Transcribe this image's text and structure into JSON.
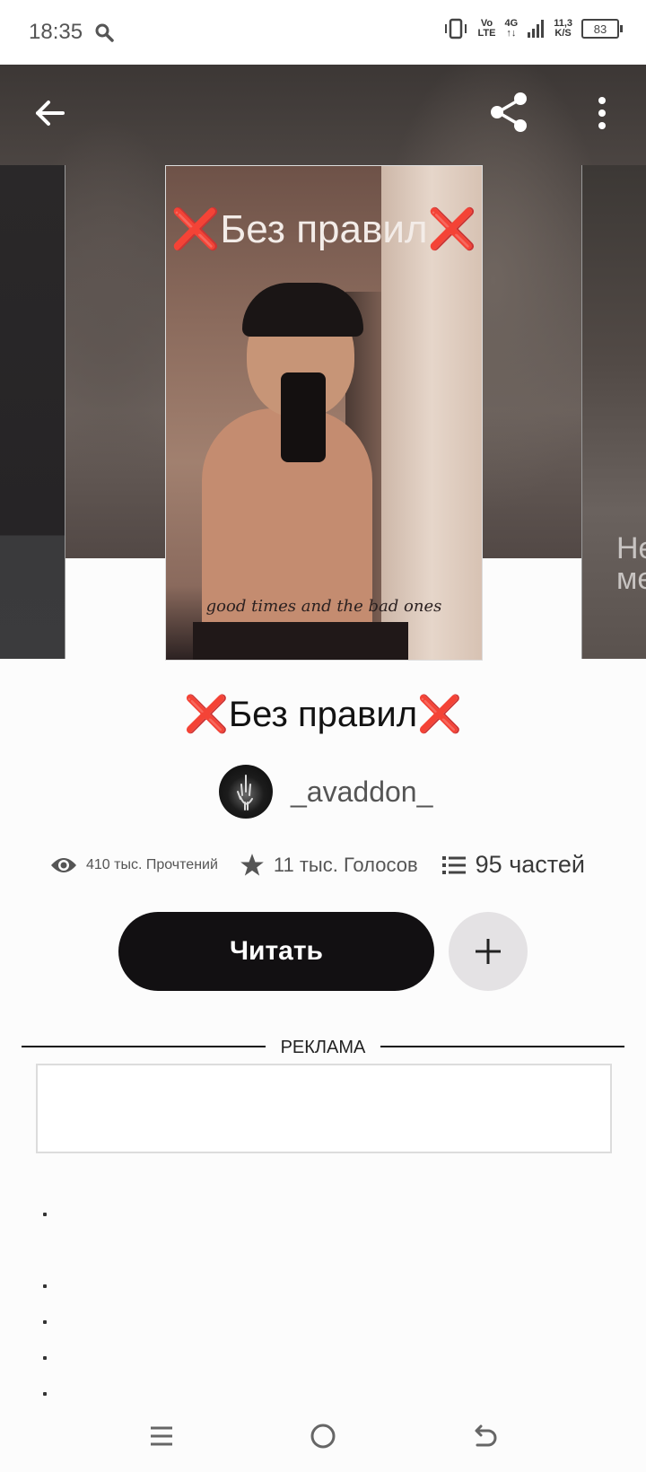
{
  "status_bar": {
    "time": "18:35",
    "network_top": "Vo",
    "network_bottom": "LTE",
    "signal_top": "4G",
    "speed_value": "11,3",
    "speed_unit": "K/S",
    "battery": "83"
  },
  "toolbar": {
    "back_icon": "arrow-left-icon",
    "share_icon": "share-icon",
    "more_icon": "more-vertical-icon"
  },
  "cover": {
    "title": "❌Без правил❌",
    "script_text": "good times and the bad ones",
    "side_right_text_line1": "Не",
    "side_right_text_line2": "ме"
  },
  "book": {
    "title": "❌Без правил❌",
    "author": "_avaddon_",
    "reads": "410 тыс. Прочтений",
    "votes": "11 тыс. Голосов",
    "parts": "95 частей"
  },
  "actions": {
    "read_label": "Читать",
    "add_icon": "plus-icon"
  },
  "ad": {
    "label": "РЕКЛАМА"
  },
  "colors": {
    "primary_button": "#121012",
    "secondary_button": "#e4e2e4",
    "text": "#121212",
    "muted": "#555555"
  }
}
